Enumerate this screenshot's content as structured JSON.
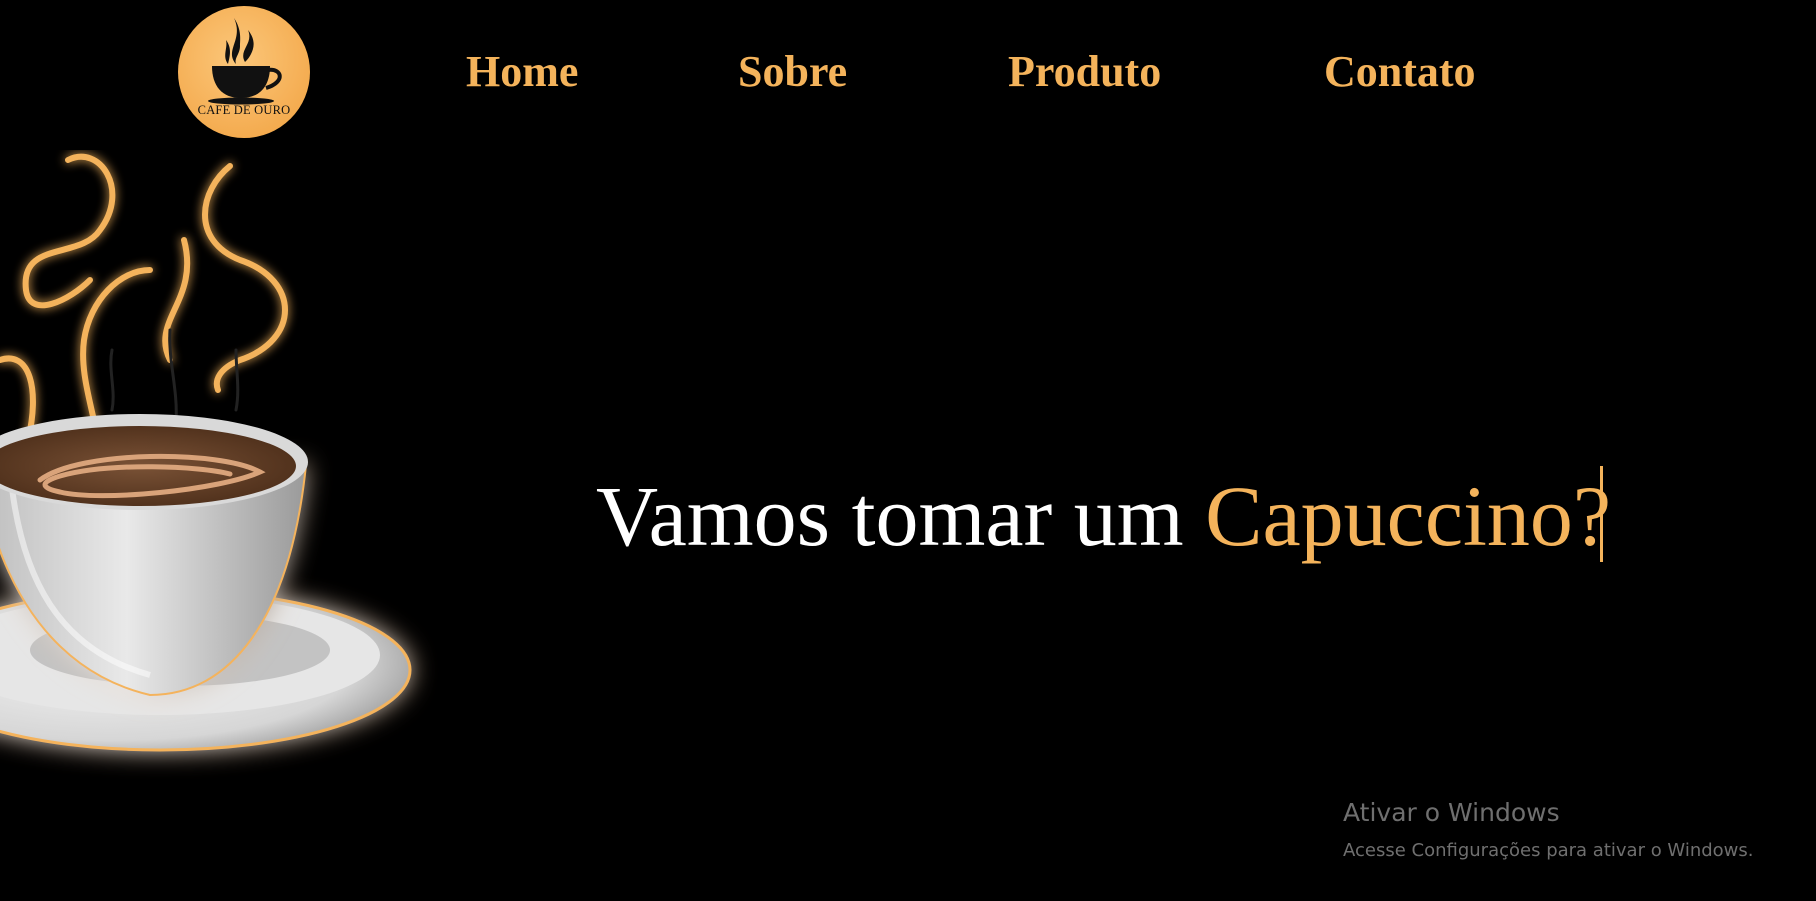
{
  "logo": {
    "text": "CAFE DE OURO",
    "icon": "coffee-cup-icon",
    "color": "#f6b25a"
  },
  "nav": {
    "items": [
      {
        "label": "Home"
      },
      {
        "label": "Sobre"
      },
      {
        "label": "Produto"
      },
      {
        "label": "Contato"
      }
    ]
  },
  "hero": {
    "text_main": "Vamos tomar um ",
    "text_accent": "Capuccino?",
    "image": "coffee-cup-illustration"
  },
  "watermark": {
    "title": "Ativar o Windows",
    "subtitle": "Acesse Configurações para ativar o Windows."
  },
  "colors": {
    "background": "#000000",
    "accent": "#f4b35b",
    "text": "#ffffff"
  }
}
